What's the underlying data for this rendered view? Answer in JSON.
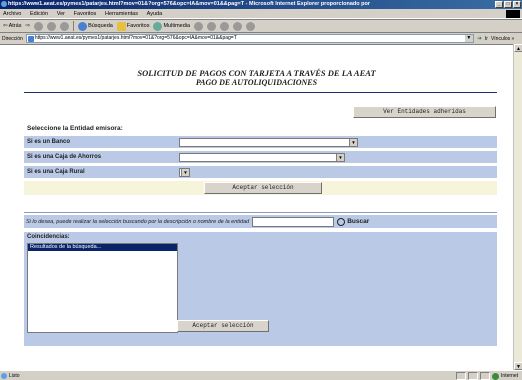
{
  "window": {
    "title": "https://www1.aeat.es/pymes1/patarjes.html?mov=01&?org=576&opc=IA&mov=01&&pag=T - Microsoft Internet Explorer proporcionado por"
  },
  "menu": [
    "Archivo",
    "Edición",
    "Ver",
    "Favoritos",
    "Herramientas",
    "Ayuda"
  ],
  "toolbar": {
    "back": "Atrás",
    "search": "Búsqueda",
    "favorites": "Favoritos",
    "multimedia": "Multimedia"
  },
  "address": {
    "label": "Dirección",
    "url": "https://www1.aeat.es/pymes1/patarjes.html?mov=01&?org=576&opc=IA&mov=01&&pag=T",
    "go": "Ir",
    "links": "Vínculos »"
  },
  "page": {
    "title_line1": "SOLICITUD DE PAGOS CON TARJETA A TRAVÉS DE LA AEAT",
    "title_line2": "PAGO DE AUTOLIQUIDACIONES",
    "ver_entidades": "Ver Entidades adheridas",
    "select_label": "Seleccione la Entidad emisora:",
    "rows": [
      {
        "label": "Si es un Banco"
      },
      {
        "label": "Si es una Caja de Ahorros"
      },
      {
        "label": "Si es una Caja Rural"
      }
    ],
    "accept_label": "Aceptar selección",
    "search_hint": "Si lo desea, puede realizar la selección buscando por la descripción o nombre de la entidad",
    "search_button": "Buscar",
    "coincidencias_label": "Coincidencias:",
    "results_option": "Resultados de la búsqueda...",
    "accept_label_2": "Aceptar selección"
  },
  "status": {
    "text": "Listo",
    "zone": "Internet"
  }
}
